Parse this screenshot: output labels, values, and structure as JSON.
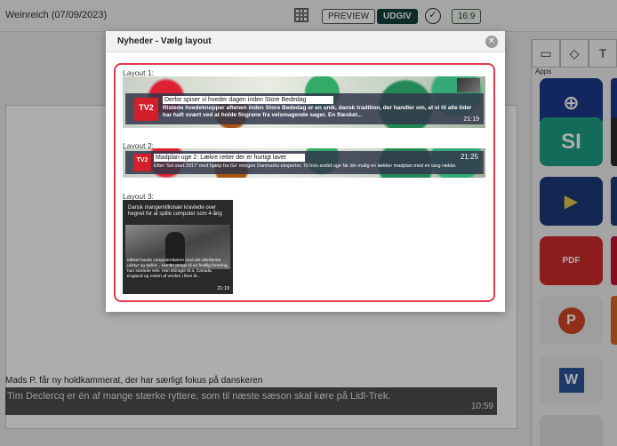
{
  "topbar": {
    "title": "Weinreich (07/09/2023)",
    "preview_label": "PREVIEW",
    "udgiv_label": "UDGIV",
    "ratio_label": "16:9"
  },
  "background": {
    "headline": "Mads P. får ny holdkammerat, der har særligt fokus på danskeren",
    "ticker_text": "Tim Declercq er én af mange stærke ryttere, som til næste sæson skal køre på Lidl-Trek.",
    "ticker_time": "10:59"
  },
  "sidebar": {
    "apps_label": "Apps",
    "tabs": [
      "image-icon",
      "shapes-icon",
      "text-icon"
    ],
    "tiles": [
      {
        "name": "globe-app-tile",
        "glyph": "🌐",
        "color": "#1a3a8a"
      },
      {
        "name": "si-app-tile",
        "glyph": "SI",
        "color": "#1c9e83"
      },
      {
        "name": "media-app-tile",
        "glyph": "▶",
        "color": "#1d3a7a"
      },
      {
        "name": "pdf-app-tile",
        "glyph": "PDF",
        "color": "#d02b2b"
      },
      {
        "name": "powerpoint-app-tile",
        "glyph": "P",
        "color": "#e9e9e9"
      },
      {
        "name": "word-app-tile",
        "glyph": "W",
        "color": "#e9e9e9"
      }
    ]
  },
  "modal": {
    "title": "Nyheder - Vælg layout",
    "close_glyph": "✕",
    "layout1": {
      "label": "Layout 1:",
      "logo": "TV2",
      "headline": "Derfor spiser vi hveder dagen inden Store Bededag",
      "body": "Ristede hvedeknopper aftenen inden Store Bededag er en unik, dansk tradition, der handler om, at vi til alle tider har haft svært ved at holde fingrene fra velsmagende sager. En flæsket...",
      "time": "21:19"
    },
    "layout2": {
      "label": "Layout 2:",
      "logo": "TV2",
      "headline": "Madplan uge 2: Lækre retter der er hurtigt lavet",
      "body": "Efter 'Sol start 2017' med hjælp fra Go' morgen Danmarks eksperter. Til hvis andet uge får din mulig en lækker madplan med en lang række...",
      "time": "21:25"
    },
    "layout3": {
      "label": "Layout 3:",
      "headline": "Dansk mangemillionær kravlede over hegnet for at spille computer som 4-årig",
      "body": "Mikkel havde computerskærm med det allerførste udstyr og spillet... samler penge til en frivillig forening, han startede selv. Han tilbragte bl.a. Canada, England og resten af verden i flere år...",
      "time": "21:19"
    }
  }
}
